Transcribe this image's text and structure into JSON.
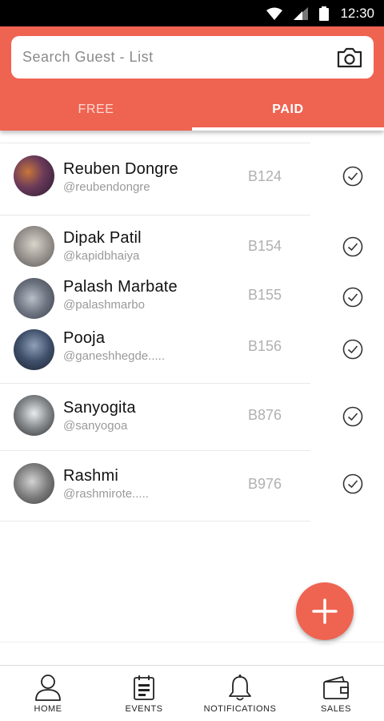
{
  "status_bar": {
    "time": "12:30"
  },
  "search": {
    "placeholder": "Search Guest - List"
  },
  "tabs": [
    {
      "label": "FREE",
      "active": false
    },
    {
      "label": "PAID",
      "active": true
    }
  ],
  "guests": [
    {
      "name": "Reuben Dongre",
      "handle": "@reubendongre",
      "code": "B124",
      "checked": true
    },
    {
      "name": "Dipak Patil",
      "handle": "@kapidbhaiya",
      "code": "B154",
      "checked": true
    },
    {
      "name": "Palash Marbate",
      "handle": "@palashmarbo",
      "code": "B155",
      "checked": true
    },
    {
      "name": "Pooja",
      "handle": "@ganeshhegde.....",
      "code": "B156",
      "checked": true
    },
    {
      "name": "Sanyogita",
      "handle": "@sanyogoa",
      "code": "B876",
      "checked": true
    },
    {
      "name": "Rashmi",
      "handle": "@rashmirote.....",
      "code": "B976",
      "checked": true
    }
  ],
  "nav": [
    {
      "label": "HOME",
      "icon": "person-icon"
    },
    {
      "label": "EVENTS",
      "icon": "events-icon"
    },
    {
      "label": "NOTIFICATIONS",
      "icon": "bell-icon"
    },
    {
      "label": "SALES",
      "icon": "wallet-icon"
    }
  ],
  "colors": {
    "accent": "#ef6351",
    "text": "#111111",
    "muted": "#9a9a9a"
  }
}
